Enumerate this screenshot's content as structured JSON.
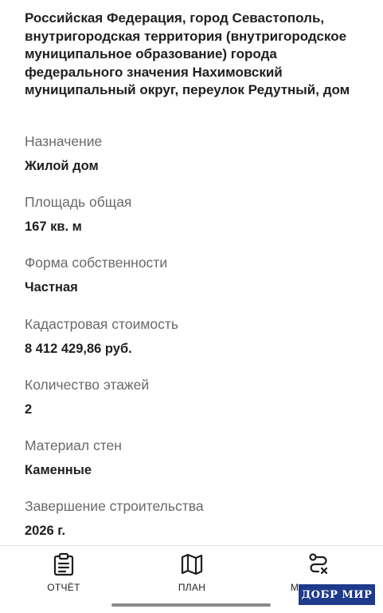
{
  "address": "Российская Федерация, город Севастополь, внутригородская территория (внутригородское муниципальное образование) города федерального значения Нахимовский муниципальный округ, переулок Редутный, дом",
  "fields": [
    {
      "label": "Назначение",
      "value": "Жилой дом"
    },
    {
      "label": "Площадь общая",
      "value": "167 кв. м"
    },
    {
      "label": "Форма собственности",
      "value": "Частная"
    },
    {
      "label": "Кадастровая стоимость",
      "value": "8 412 429,86 руб."
    },
    {
      "label": "Количество этажей",
      "value": "2"
    },
    {
      "label": "Материал стен",
      "value": "Каменные"
    },
    {
      "label": "Завершение строительства",
      "value": "2026 г."
    }
  ],
  "nav": {
    "items": [
      {
        "label": "ОТЧЁТ",
        "icon": "clipboard-icon"
      },
      {
        "label": "ПЛАН",
        "icon": "map-icon"
      },
      {
        "label": "М",
        "icon": "route-icon"
      }
    ]
  },
  "watermark": "ДОБР МИР",
  "colors": {
    "text": "#1f1f1f",
    "label": "#6a6a6a",
    "watermark_bg": "#1f3a8a"
  }
}
